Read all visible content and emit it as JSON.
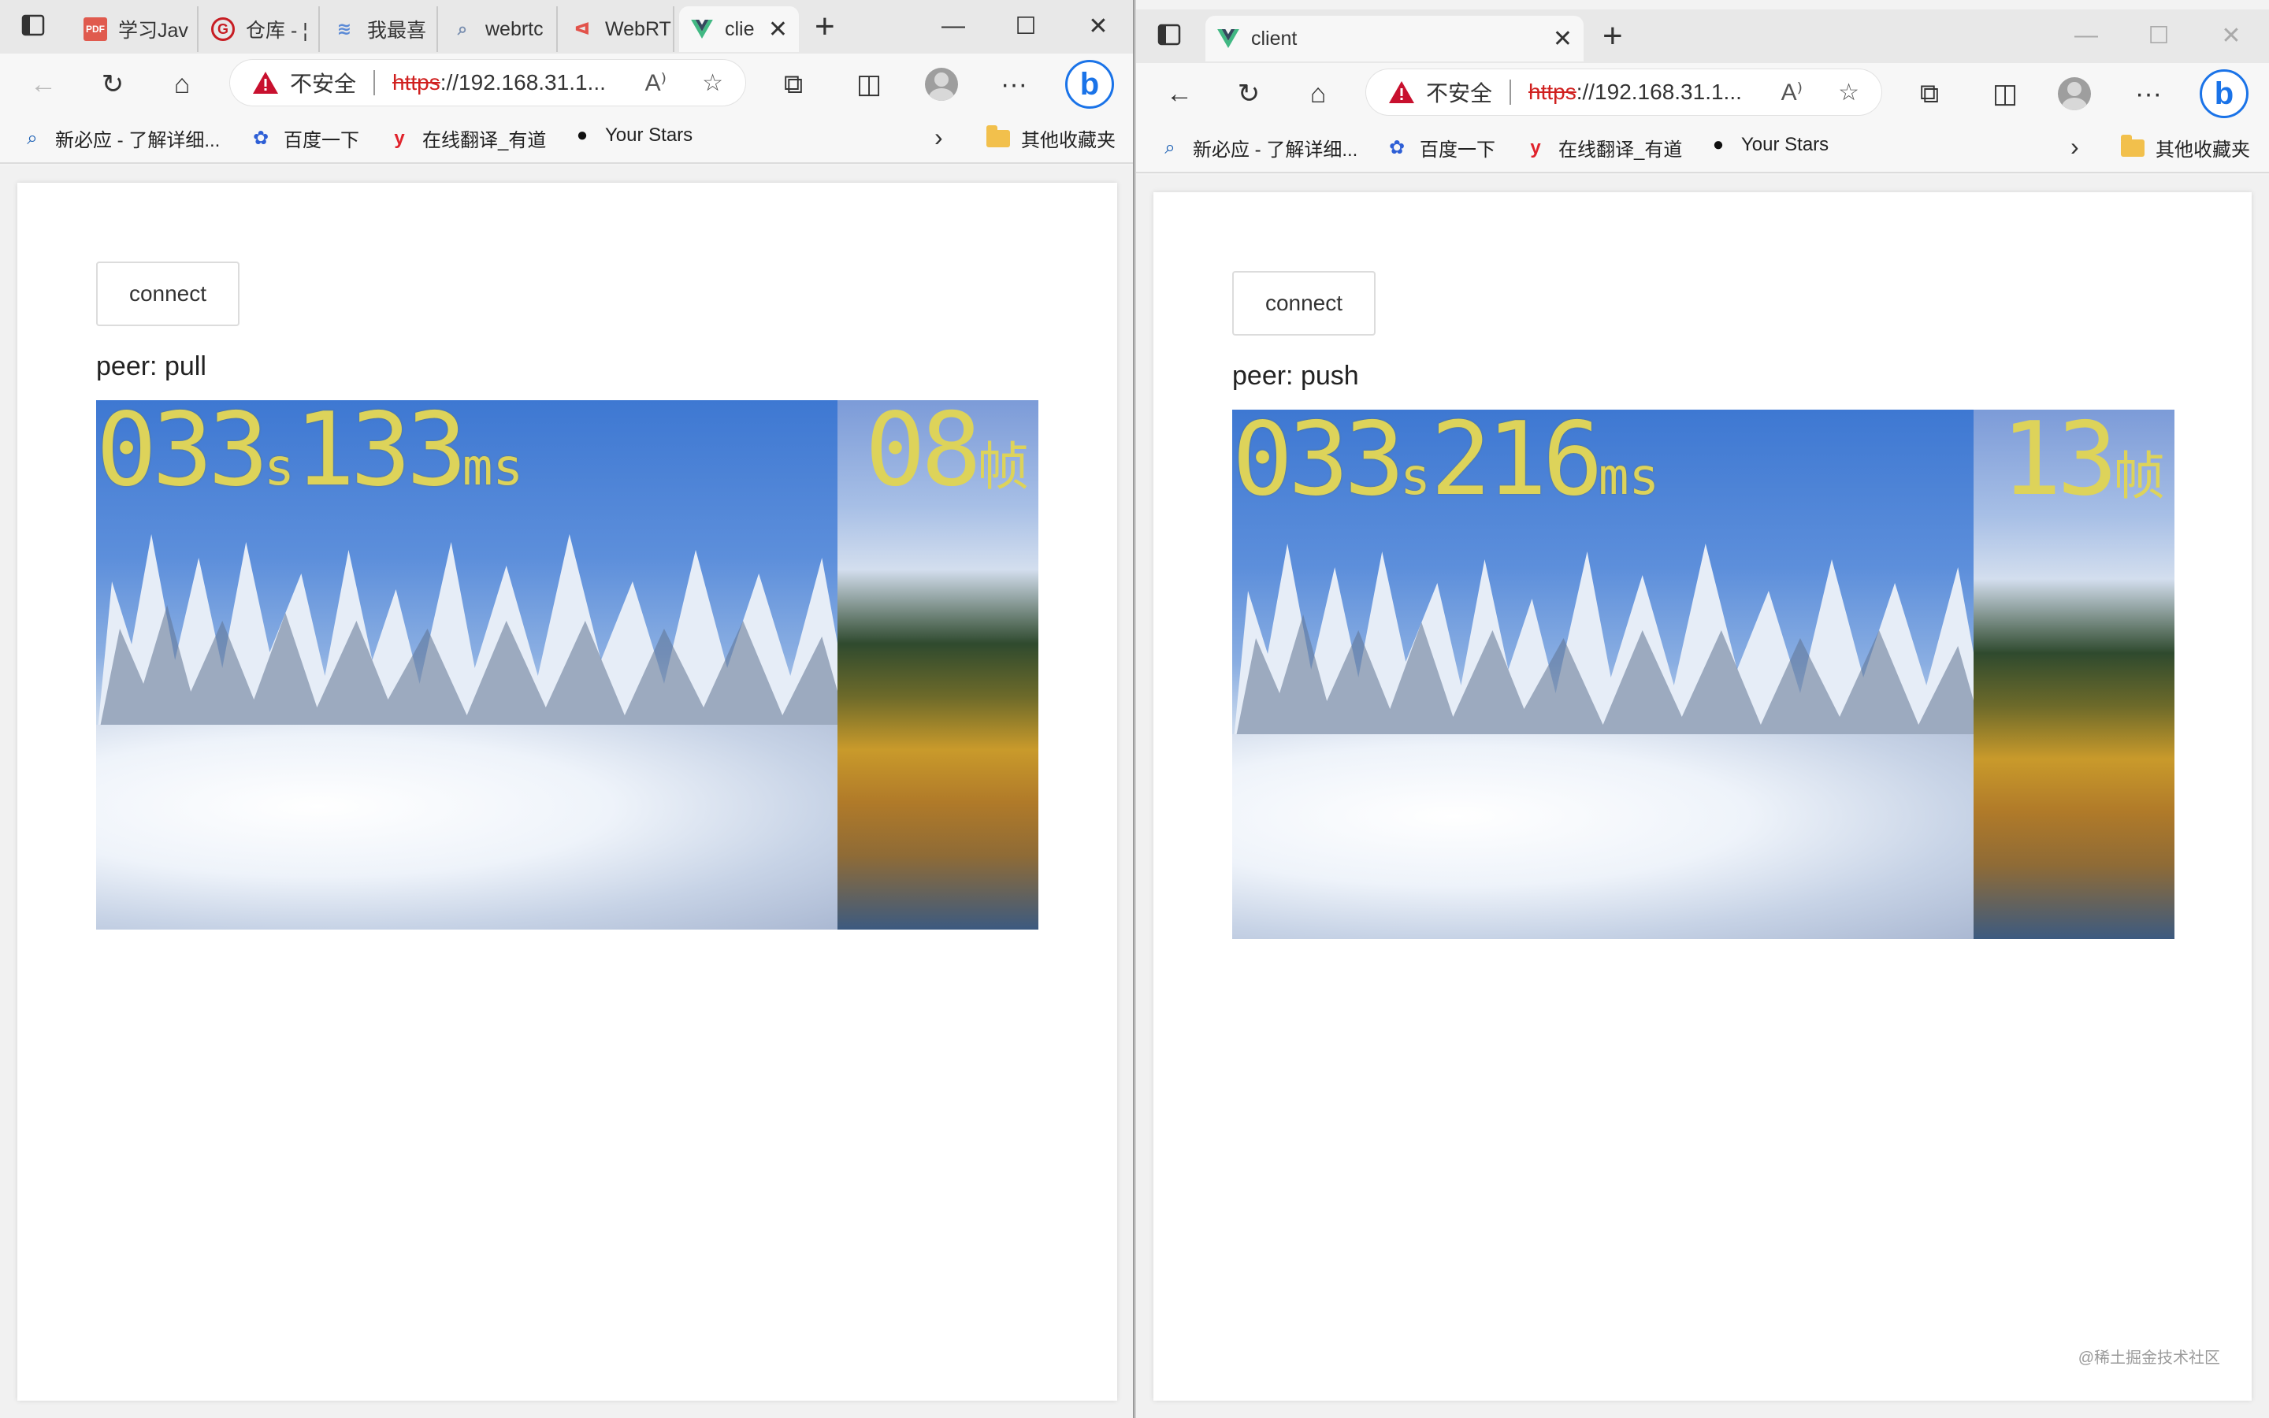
{
  "left_window": {
    "tabs": [
      {
        "label": "学习Jav",
        "icon": "pdf-icon"
      },
      {
        "label": "仓库 - ¦",
        "icon": "gitee-icon"
      },
      {
        "label": "我最喜",
        "icon": "layers-icon"
      },
      {
        "label": "webrtc",
        "icon": "search-icon"
      },
      {
        "label": "WebRT",
        "icon": "flame-icon"
      },
      {
        "label": "clie",
        "icon": "vue-icon",
        "active": true
      }
    ],
    "address": {
      "insecure_label": "不安全",
      "scheme": "https",
      "host": "://192.168.31.1..."
    },
    "page": {
      "button_label": "connect",
      "peer_label": "peer: pull",
      "time_sec": "033",
      "sec_unit": "s",
      "time_ms": "133",
      "ms_unit": "ms",
      "frame_num": "08",
      "frame_unit": "帧"
    }
  },
  "right_window": {
    "tabs": [
      {
        "label": "client",
        "icon": "vue-icon",
        "active": true
      }
    ],
    "address": {
      "insecure_label": "不安全",
      "scheme": "https",
      "host": "://192.168.31.1..."
    },
    "page": {
      "button_label": "connect",
      "peer_label": "peer: push",
      "time_sec": "033",
      "sec_unit": "s",
      "time_ms": "216",
      "ms_unit": "ms",
      "frame_num": "13",
      "frame_unit": "帧"
    }
  },
  "bookmarks": [
    {
      "label": "新必应 - 了解详细...",
      "icon": "search-icon"
    },
    {
      "label": "百度一下",
      "icon": "baidu-paw-icon"
    },
    {
      "label": "在线翻译_有道",
      "icon": "youdao-icon"
    },
    {
      "label": "Your Stars",
      "icon": "github-icon"
    }
  ],
  "other_bookmarks_label": "其他收藏夹",
  "watermark": "@稀土掘金技术社区",
  "colors": {
    "overlay_text": "#ddd35a",
    "insecure_red": "#d0201f",
    "vue_green": "#41b883"
  }
}
